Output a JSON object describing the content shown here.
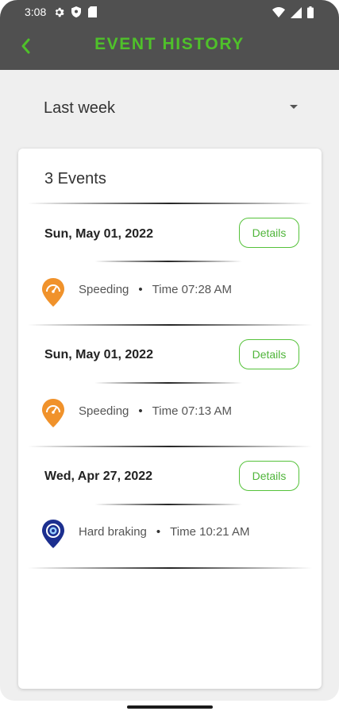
{
  "status_bar": {
    "time": "3:08",
    "icons": [
      "gear-icon",
      "shield-icon",
      "sim-card-icon",
      "wifi-icon",
      "signal-icon",
      "battery-icon"
    ]
  },
  "header": {
    "title": "EVENT HISTORY",
    "back_icon": "chevron-left-icon",
    "title_color": "#4fc12a",
    "bar_color": "#505050"
  },
  "period": {
    "selected": "Last week",
    "icon": "caret-down-icon"
  },
  "events_card": {
    "count_label": "3 Events",
    "events": [
      {
        "date": "Sun, May 01, 2022",
        "details_label": "Details",
        "type": "Speeding",
        "separator": "•",
        "time": "Time 07:28 AM",
        "icon": "speedometer-pin-icon",
        "icon_color": "#f0922b"
      },
      {
        "date": "Sun, May 01, 2022",
        "details_label": "Details",
        "type": "Speeding",
        "separator": "•",
        "time": "Time 07:13 AM",
        "icon": "speedometer-pin-icon",
        "icon_color": "#f0922b"
      },
      {
        "date": "Wed, Apr 27, 2022",
        "details_label": "Details",
        "type": "Hard braking",
        "separator": "•",
        "time": "Time 10:21 AM",
        "icon": "brake-pin-icon",
        "icon_color": "#1c2f8f"
      }
    ]
  },
  "colors": {
    "accent": "#4fc12a",
    "background": "#efefef",
    "card": "#ffffff"
  }
}
